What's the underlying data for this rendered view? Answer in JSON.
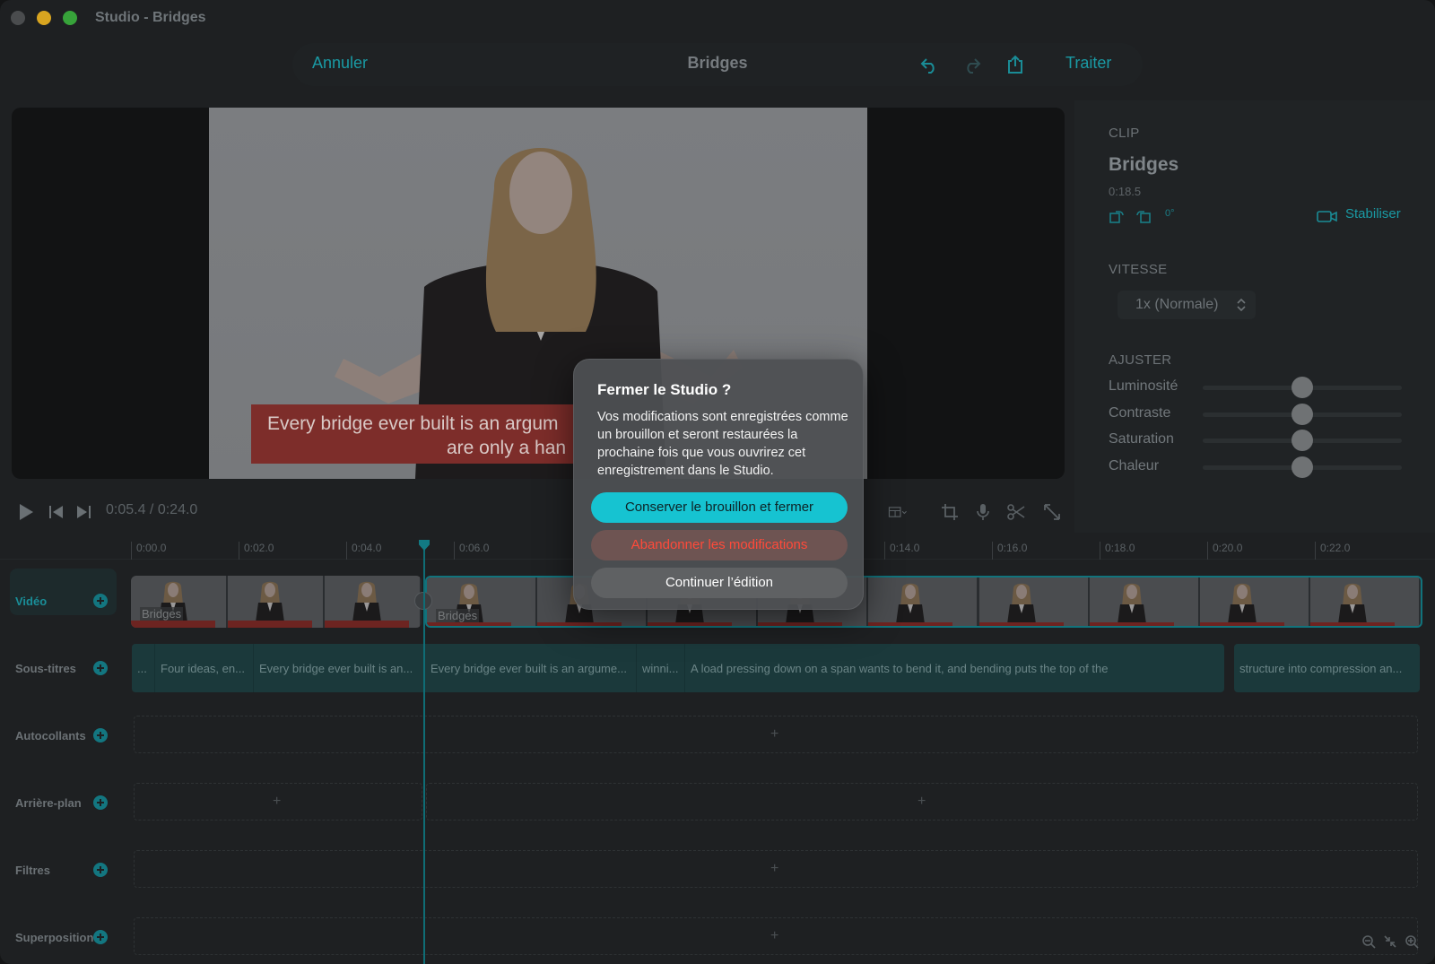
{
  "window": {
    "title": "Studio - Bridges"
  },
  "toolbar": {
    "cancel_label": "Annuler",
    "title": "Bridges",
    "process_label": "Traiter"
  },
  "preview": {
    "caption_line1": "Every bridge ever built is an argum",
    "caption_line2": "are only a han"
  },
  "inspector": {
    "clip_section": "CLIP",
    "clip_name": "Bridges",
    "clip_duration": "0:18.5",
    "rotation": "0°",
    "stabilize_label": "Stabiliser",
    "speed_section": "VITESSE",
    "speed_value": "1x (Normale)",
    "adjust_section": "AJUSTER",
    "adjustments": [
      {
        "label": "Luminosité",
        "value": 0.5
      },
      {
        "label": "Contraste",
        "value": 0.5
      },
      {
        "label": "Saturation",
        "value": 0.5
      },
      {
        "label": "Chaleur",
        "value": 0.5
      }
    ]
  },
  "transport": {
    "timecode": "0:05.4 / 0:24.0"
  },
  "ruler": {
    "ticks": [
      "0:00.0",
      "0:02.0",
      "0:04.0",
      "0:06.0",
      "0:14.0",
      "0:16.0",
      "0:18.0",
      "0:20.0",
      "0:22.0"
    ]
  },
  "tracks": {
    "video": "Vidéo",
    "subtitles": "Sous-titres",
    "stickers": "Autocollants",
    "background": "Arrière-plan",
    "filters": "Filtres",
    "overlay": "Superposition"
  },
  "video_clips": [
    {
      "name": "Bridges"
    },
    {
      "name": "Bridges"
    }
  ],
  "subtitles": [
    "...",
    "Four ideas, en...",
    "Every bridge ever built is an...",
    "Every bridge ever built is an argume...",
    "winni...",
    "A load pressing down on a span wants to bend it, and bending puts the top of the",
    "structure into compression an..."
  ],
  "lane_plus": "+",
  "dialog": {
    "title": "Fermer le Studio ?",
    "body": "Vos modifications sont enregistrées comme un brouillon et seront restaurées la prochaine fois que vous ouvrirez cet enregistrement dans le Studio.",
    "keep_label": "Conserver le brouillon et fermer",
    "discard_label": "Abandonner les modifications",
    "continue_label": "Continuer l’édition"
  },
  "colors": {
    "accent": "#16c3d1",
    "danger": "#ff4a3a",
    "background": "#1e2022"
  }
}
